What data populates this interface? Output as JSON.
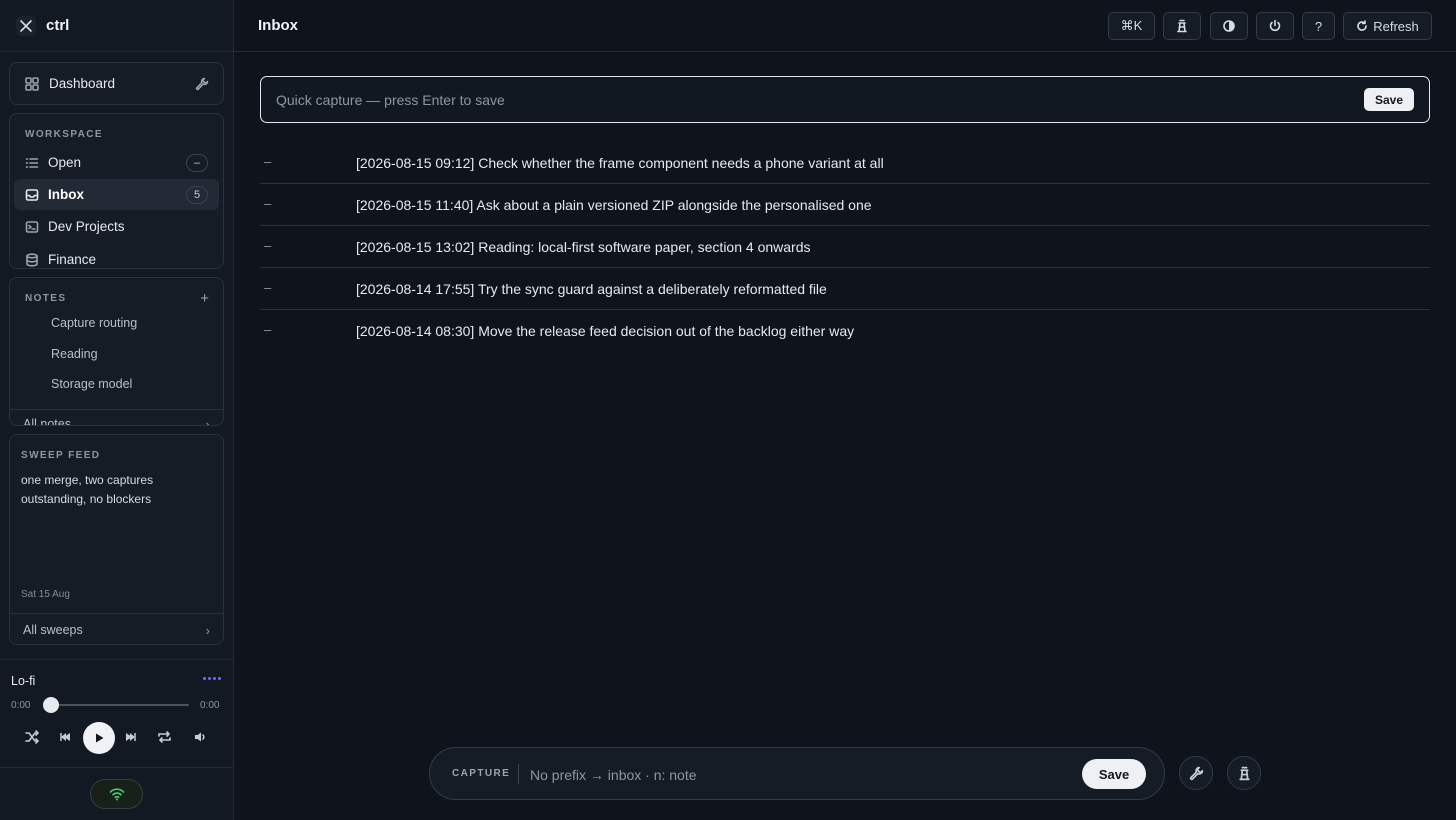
{
  "app": {
    "name": "ctrl"
  },
  "sidebar": {
    "dashboard_label": "Dashboard",
    "workspace": {
      "heading": "WORKSPACE",
      "items": [
        {
          "label": "Open",
          "badge": "–"
        },
        {
          "label": "Inbox",
          "badge": "5",
          "active": true
        },
        {
          "label": "Dev Projects"
        },
        {
          "label": "Finance"
        }
      ]
    },
    "notes": {
      "heading": "NOTES",
      "items": [
        "Capture routing",
        "Reading",
        "Storage model"
      ],
      "footer": "All notes"
    },
    "sweep": {
      "heading": "SWEEP FEED",
      "text": "one merge, two captures outstanding, no blockers",
      "date": "Sat 15 Aug",
      "footer": "All sweeps"
    },
    "player": {
      "title": "Lo-fi",
      "elapsed": "0:00",
      "duration": "0:00",
      "progress": 0
    }
  },
  "header": {
    "title": "Inbox",
    "command_label": "⌘K",
    "help_label": "?",
    "refresh_label": "Refresh"
  },
  "quick_capture": {
    "placeholder": "Quick capture — press Enter to save",
    "save_label": "Save"
  },
  "inbox": {
    "items": [
      {
        "marker": "–",
        "text": "[2026-08-15 09:12] Check whether the frame component needs a phone variant at all"
      },
      {
        "marker": "–",
        "text": "[2026-08-15 11:40] Ask about a plain versioned ZIP alongside the personalised one"
      },
      {
        "marker": "–",
        "text": "[2026-08-15 13:02] Reading: local-first software paper, section 4 onwards"
      },
      {
        "marker": "–",
        "text": "[2026-08-14 17:55] Try the sync guard against a deliberately reformatted file"
      },
      {
        "marker": "–",
        "text": "[2026-08-14 08:30] Move the release feed decision out of the backlog either way"
      }
    ]
  },
  "capture_bar": {
    "tag": "CAPTURE",
    "placeholder": "No prefix → inbox · n: note",
    "save_label": "Save"
  },
  "colors": {
    "background": "#0f141c",
    "sidebar": "#121923",
    "accent_dots": "#6d6cf2",
    "network_ok": "#4ccf6a"
  },
  "icons": {
    "brand": "x-cross-icon",
    "dashboard": "grid-icon",
    "wrench": "wrench-icon",
    "open": "list-icon",
    "inbox": "inbox-icon",
    "dev_projects": "terminal-icon",
    "finance": "database-icon",
    "lighthouse": "lighthouse-icon",
    "theme": "contrast-icon",
    "power": "power-icon",
    "refresh": "refresh-icon",
    "wifi": "wifi-icon"
  }
}
